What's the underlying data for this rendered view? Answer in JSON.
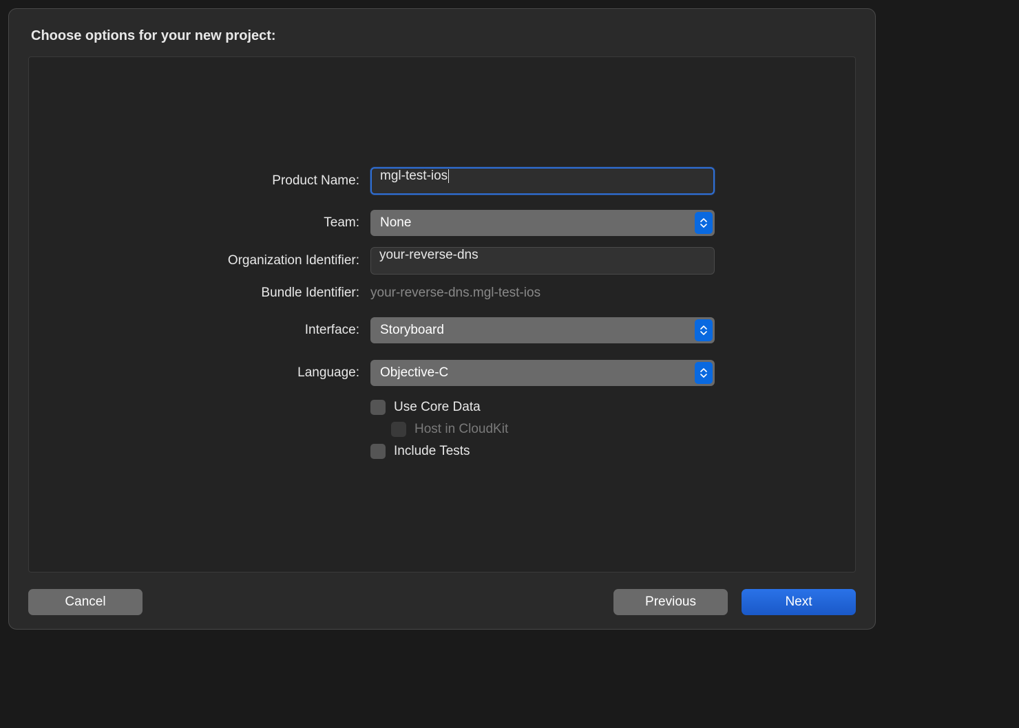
{
  "dialog": {
    "title": "Choose options for your new project:"
  },
  "form": {
    "product_name": {
      "label": "Product Name:",
      "value": "mgl-test-ios"
    },
    "team": {
      "label": "Team:",
      "value": "None"
    },
    "org_identifier": {
      "label": "Organization Identifier:",
      "value": "your-reverse-dns"
    },
    "bundle_identifier": {
      "label": "Bundle Identifier:",
      "value": "your-reverse-dns.mgl-test-ios"
    },
    "interface": {
      "label": "Interface:",
      "value": "Storyboard"
    },
    "language": {
      "label": "Language:",
      "value": "Objective-C"
    },
    "use_core_data": {
      "label": "Use Core Data",
      "checked": false
    },
    "host_cloudkit": {
      "label": "Host in CloudKit",
      "checked": false,
      "enabled": false
    },
    "include_tests": {
      "label": "Include Tests",
      "checked": false
    }
  },
  "footer": {
    "cancel": "Cancel",
    "previous": "Previous",
    "next": "Next"
  }
}
